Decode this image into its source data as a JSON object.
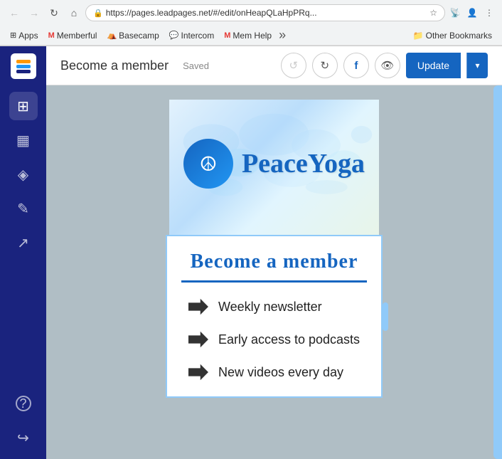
{
  "browser": {
    "nav": {
      "back_disabled": true,
      "forward_disabled": true,
      "reload_label": "↻",
      "home_label": "⌂",
      "secure_label": "🔒 Secure",
      "url": "https://pages.leadpages.net/#/edit/onHeapQLaHpPRq...",
      "star_label": "☆",
      "extensions_more": "⋮"
    },
    "bookmarks": [
      {
        "id": "apps",
        "icon": "⊞",
        "label": "Apps"
      },
      {
        "id": "memberful",
        "icon": "M",
        "label": "Memberful"
      },
      {
        "id": "basecamp",
        "icon": "⛺",
        "label": "Basecamp"
      },
      {
        "id": "intercom",
        "icon": "💬",
        "label": "Intercom"
      },
      {
        "id": "mem-help",
        "icon": "M",
        "label": "Mem Help"
      }
    ],
    "other_bookmarks_label": "Other Bookmarks"
  },
  "sidebar": {
    "logo_alt": "Leadpages logo",
    "items": [
      {
        "id": "dashboard",
        "icon": "⊞",
        "label": "Dashboard",
        "active": true
      },
      {
        "id": "widgets",
        "icon": "⊟",
        "label": "Widgets"
      },
      {
        "id": "layers",
        "icon": "◈",
        "label": "Layers"
      },
      {
        "id": "pen",
        "icon": "✎",
        "label": "Pen tool"
      },
      {
        "id": "analytics",
        "icon": "↗",
        "label": "Analytics"
      }
    ],
    "bottom_items": [
      {
        "id": "help",
        "icon": "?",
        "label": "Help"
      },
      {
        "id": "account",
        "icon": "↪",
        "label": "Account"
      }
    ]
  },
  "topbar": {
    "page_title": "Become a member",
    "saved_label": "Saved",
    "undo_label": "↺",
    "redo_label": "↻",
    "facebook_label": "f",
    "preview_label": "👁",
    "update_label": "Update",
    "update_dropdown_label": "▾"
  },
  "canvas": {
    "logo_text": "PeaceYoga",
    "logo_icon": "☮",
    "section_heading": "Become a member",
    "section_underline_color": "#1565c0",
    "features": [
      {
        "id": "feature-1",
        "text": "Weekly newsletter"
      },
      {
        "id": "feature-2",
        "text": "Early access to podcasts"
      },
      {
        "id": "feature-3",
        "text": "New videos every day"
      }
    ]
  }
}
